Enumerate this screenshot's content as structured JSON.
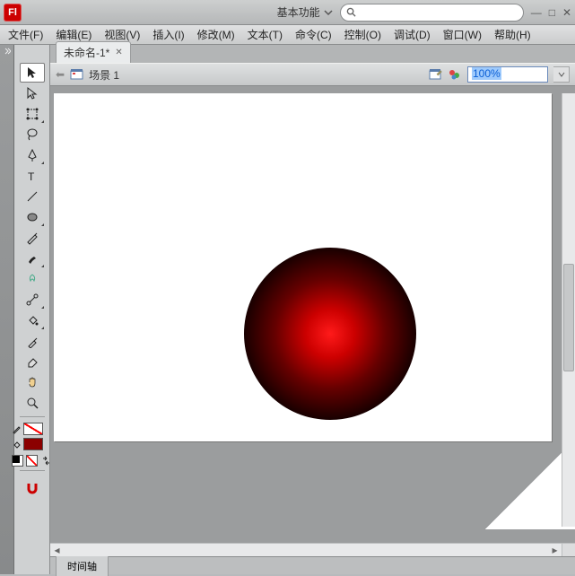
{
  "titlebar": {
    "app_abbr": "Fl",
    "workspace_label": "基本功能",
    "search_value": ""
  },
  "menu": {
    "file": "文件(F)",
    "edit": "编辑(E)",
    "view": "视图(V)",
    "insert": "插入(I)",
    "modify": "修改(M)",
    "text": "文本(T)",
    "commands": "命令(C)",
    "control": "控制(O)",
    "debug": "调试(D)",
    "window": "窗口(W)",
    "help": "帮助(H)"
  },
  "tabs": {
    "doc1": "未命名-1*"
  },
  "edit_toolbar": {
    "scene_label": "场景 1",
    "zoom": "100%"
  },
  "timeline": {
    "label": "时间轴"
  },
  "tools": {
    "selection": "selection",
    "subselection": "subselection",
    "free_transform": "free-transform",
    "lasso": "lasso",
    "pen": "pen",
    "text": "text",
    "line": "line",
    "rectangle": "rectangle",
    "pencil": "pencil",
    "brush": "brush",
    "deco": "deco",
    "bone": "bone",
    "paint_bucket": "paint-bucket",
    "eyedropper": "eyedropper",
    "eraser": "eraser",
    "hand": "hand",
    "zoom": "zoom"
  }
}
